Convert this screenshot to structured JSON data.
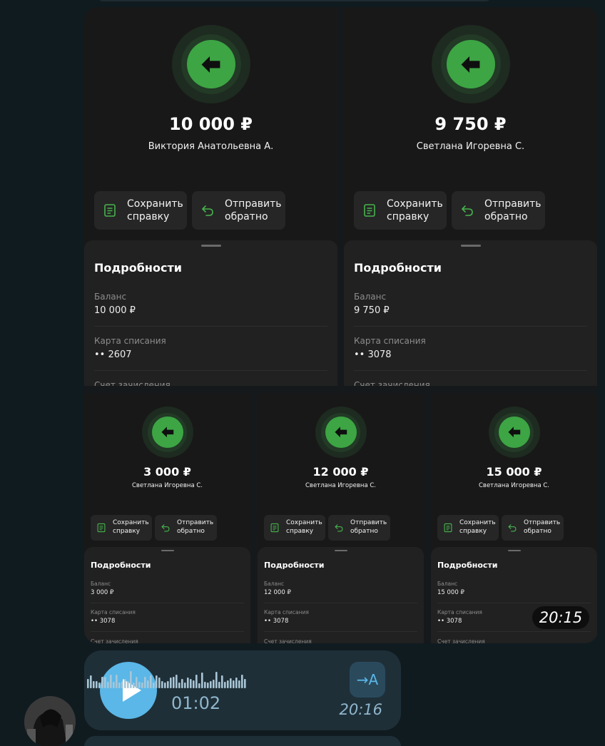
{
  "colors": {
    "background": "#101b20",
    "accent_green": "#3da544",
    "bubble": "#1f2f38",
    "play_blue": "#5ab7e8"
  },
  "cards_large": [
    {
      "amount": "10 000 ₽",
      "payer": "Виктория Анатольевна А.",
      "save": "Сохранить\nсправку",
      "return": "Отправить\nобратно",
      "details_title": "Подробности",
      "balance_label": "Баланс",
      "balance_value": "10 000 ₽",
      "card_label": "Карта списания",
      "card_value": "•• 2607",
      "account_label": "Счет зачисления"
    },
    {
      "amount": "9 750 ₽",
      "payer": "Светлана Игоревна С.",
      "save": "Сохранить\nсправку",
      "return": "Отправить\nобратно",
      "details_title": "Подробности",
      "balance_label": "Баланс",
      "balance_value": "9 750 ₽",
      "card_label": "Карта списания",
      "card_value": "•• 3078",
      "account_label": "Счет зачисления"
    }
  ],
  "cards_small": [
    {
      "amount": "3 000 ₽",
      "payer": "Светлана Игоревна С.",
      "save": "Сохранить\nсправку",
      "return": "Отправить\nобратно",
      "details_title": "Подробности",
      "balance_label": "Баланс",
      "balance_value": "3 000 ₽",
      "card_label": "Карта списания",
      "card_value": "•• 3078",
      "account_label": "Счет зачисления"
    },
    {
      "amount": "12 000 ₽",
      "payer": "Светлана Игоревна С.",
      "save": "Сохранить\nсправку",
      "return": "Отправить\nобратно",
      "details_title": "Подробности",
      "balance_label": "Баланс",
      "balance_value": "12 000 ₽",
      "card_label": "Карта списания",
      "card_value": "•• 3078",
      "account_label": "Счет зачисления"
    },
    {
      "amount": "15 000 ₽",
      "payer": "Светлана Игоревна С.",
      "save": "Сохранить\nсправку",
      "return": "Отправить\nобратно",
      "details_title": "Подробности",
      "balance_label": "Баланс",
      "balance_value": "15 000 ₽",
      "card_label": "Карта списания",
      "card_value": "•• 3078",
      "account_label": "Счет зачисления"
    }
  ],
  "album_time": "20:15",
  "voice": {
    "duration": "01:02",
    "time": "20:16",
    "transcribe_icon": "→A"
  }
}
